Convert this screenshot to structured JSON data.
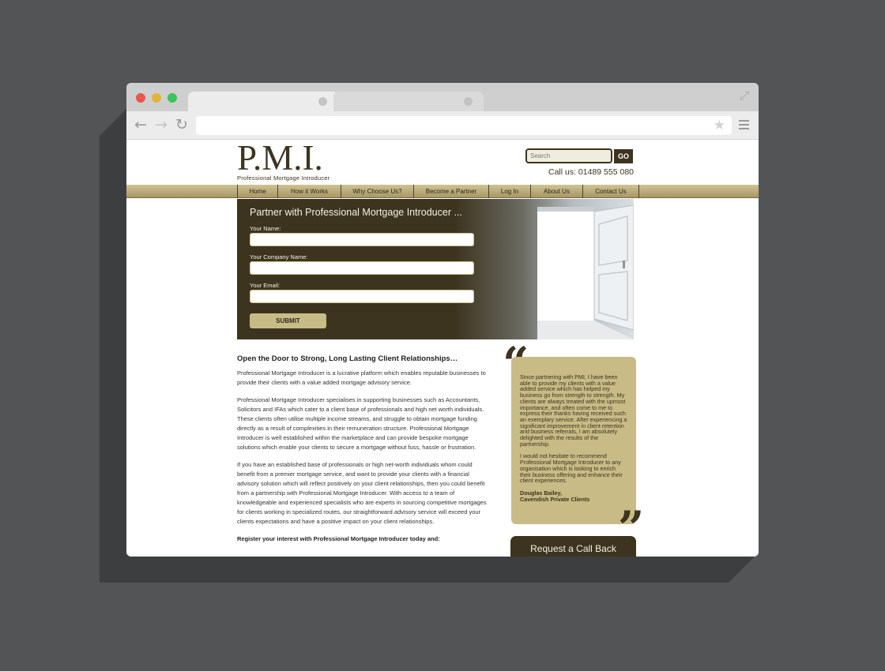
{
  "site": {
    "logo_main": "P.M.I.",
    "logo_sub": "Professional Mortgage Introducer",
    "search_placeholder": "Search",
    "search_button": "GO",
    "phone": "Call us: 01489 555 080"
  },
  "nav": [
    {
      "label": "Home"
    },
    {
      "label": "How it Works"
    },
    {
      "label": "Why Choose Us?"
    },
    {
      "label": "Become a Partner"
    },
    {
      "label": "Log In"
    },
    {
      "label": "About Us"
    },
    {
      "label": "Contact Us"
    }
  ],
  "hero": {
    "title": "Partner with Professional Mortgage Introducer ...",
    "name_label": "Your Name:",
    "company_label": "Your Company Name:",
    "email_label": "Your Email:",
    "submit_label": "SUBMIT"
  },
  "content": {
    "heading": "Open the Door to Strong, Long Lasting Client Relationships…",
    "p1": "Professional Mortgage Introducer is a lucrative platform which enables reputable businesses to provide their clients with a value added mortgage advisory service.",
    "p2": "Professional Mortgage Introducer specialises in supporting businesses such as Accountants, Solicitors and IFAs which cater to a client base of professionals and high net worth individuals. These clients often utilise multiple income streams, and struggle to obtain mortgage funding directly as a result of complexities in their remuneration structure. Professional Mortgage Introducer is well established within the marketplace and can provide bespoke mortgage solutions which enable your clients to secure a mortgage without fuss, hassle or frustration.",
    "p3": "If you have an established base of professionals or high net-worth individuals whom could benefit from a premier mortgage service, and want to provide your clients with a financial advisory solution which will reflect positively on your client relationships, then you could benefit from a partnership with Professional Mortgage Introducer. With access to a team of knowledgeable and experienced specialists who are experts in sourcing competitive mortgages for clients working in specialized routes, our straightforward advisory service will exceed your clients expectations and have a positive impact on your client relationships.",
    "cta": "Register your interest with Professional Mortgage Introducer today and:"
  },
  "testimonial": {
    "text1": "Since partnering with PMI, I have been able to provide my clients with a value added service which has helped my business go from strength to strength. My clients are always treated with the upmost importance, and often come to me to express their thanks having received such an exemplary service. After experiencing a significant improvement in client retention and business referrals, I am absolutely delighted with the results of the partnership.",
    "text2": "I would not hesitate to recommend Professional Mortgage Introducer to any organisation which is looking to enrich their business offering and enhance their client experiences.",
    "author_name": "Douglas Bailey,",
    "author_company": "Cavendish Private Clients"
  },
  "callback": {
    "label": "Request a Call Back"
  },
  "colors": {
    "brand_dark": "#3d3420",
    "brand_gold": "#c8bb86"
  }
}
